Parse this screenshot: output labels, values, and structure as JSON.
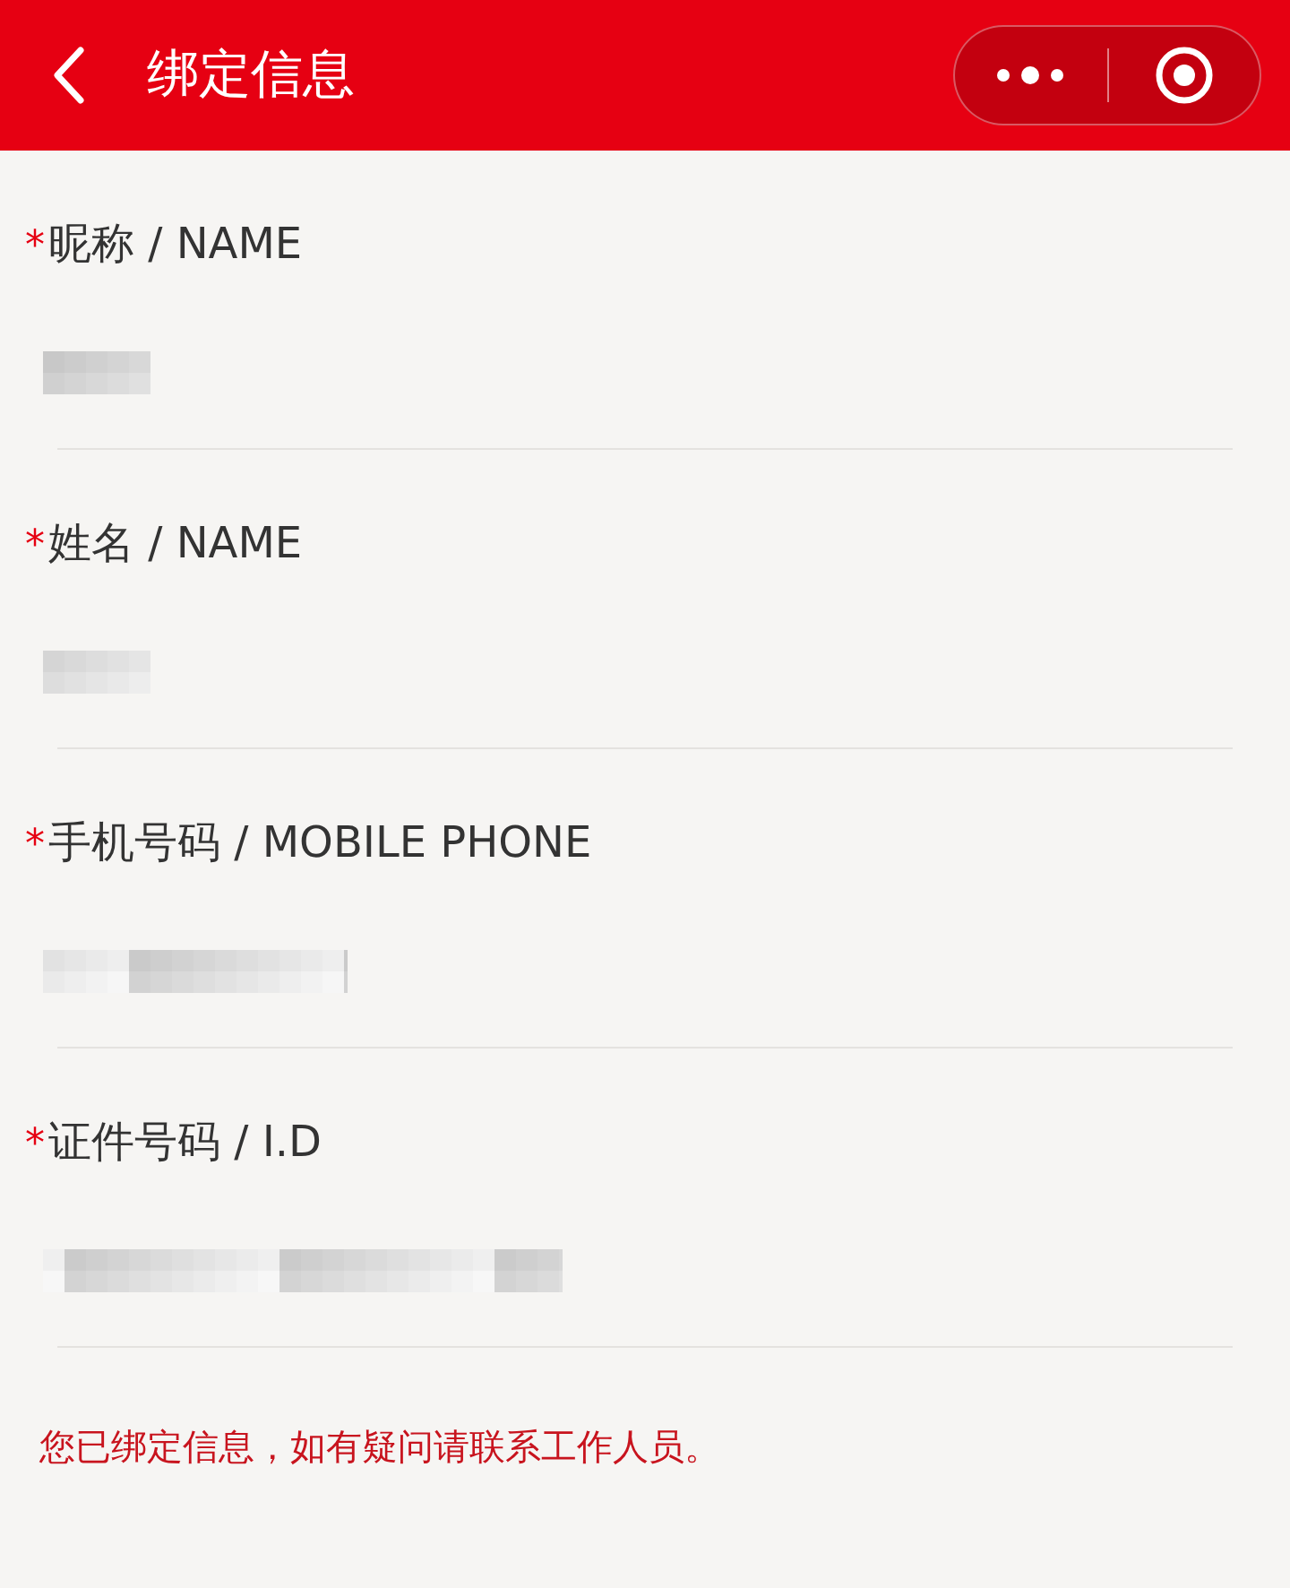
{
  "header": {
    "title": "绑定信息"
  },
  "fields": [
    {
      "label": "昵称 / NAME",
      "required": true,
      "required_mark": "*"
    },
    {
      "label": "姓名 / NAME",
      "required": true,
      "required_mark": "*"
    },
    {
      "label": "手机号码 / MOBILE PHONE",
      "required": true,
      "required_mark": "*"
    },
    {
      "label": "证件号码 / I.D",
      "required": true,
      "required_mark": "*"
    }
  ],
  "notice": "您已绑定信息，如有疑问请联系工作人员。"
}
